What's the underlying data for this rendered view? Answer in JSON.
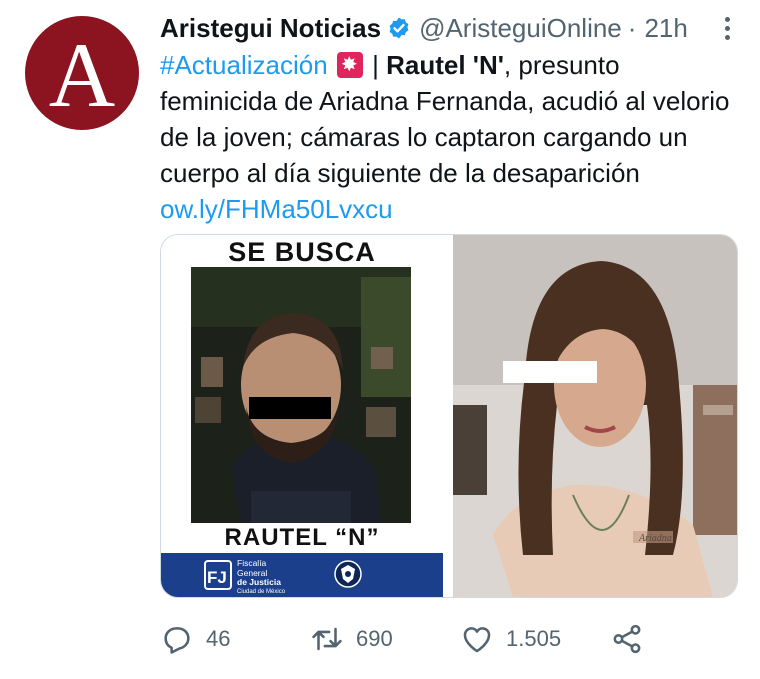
{
  "tweet": {
    "author_name": "Aristegui Noticias",
    "avatar_letter": "A",
    "handle": "@AristeguiOnline",
    "separator": "·",
    "time": "21h",
    "hashtag": "#Actualización",
    "pipe": " | ",
    "bold_name": "Rautel 'N'",
    "body": ", presunto feminicida de Ariadna Fernanda, acudió al velorio de la joven; cámaras lo captaron cargando un cuerpo al día siguiente de la desaparición ",
    "link": "ow.ly/FHMa50Lvxcu"
  },
  "media": {
    "poster_heading": "SE BUSCA",
    "poster_name": "RAUTEL “N”",
    "agency_line1": "Fiscalía",
    "agency_line2": "General",
    "agency_line3": "de Justicia",
    "agency_line4": "Ciudad de México",
    "tattoo_text": "Ariadna"
  },
  "actions": {
    "replies": "46",
    "retweets": "690",
    "likes": "1.505"
  },
  "colors": {
    "brand": "#8b1420",
    "link": "#1d9bf0",
    "verified": "#1d9bf0",
    "muted": "#536471",
    "poster_footer": "#1b3f8b"
  }
}
